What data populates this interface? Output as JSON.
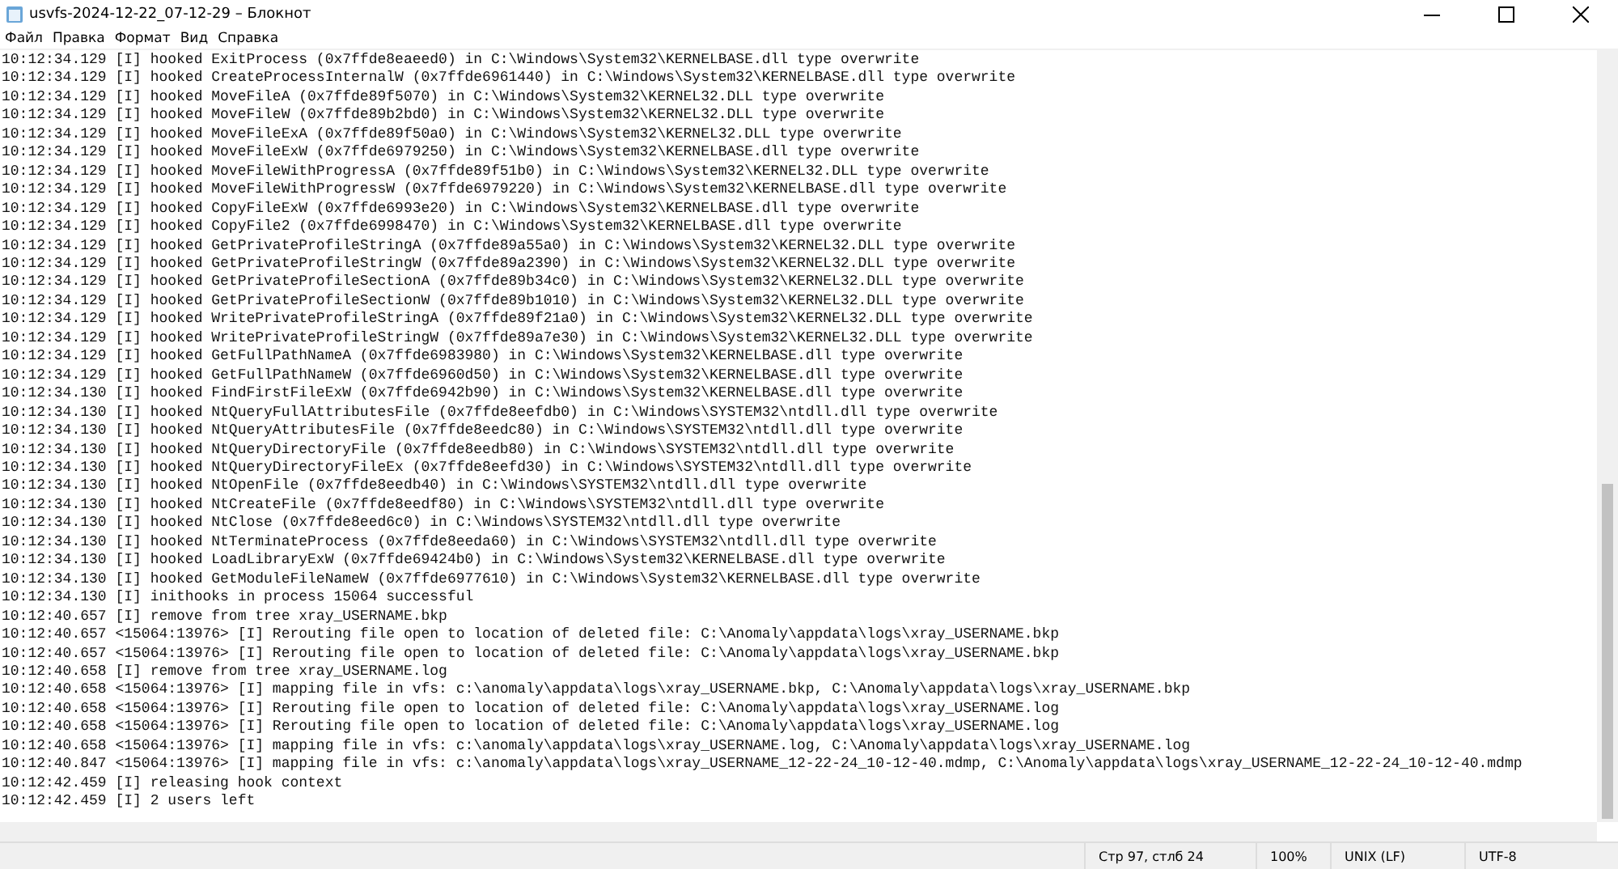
{
  "window": {
    "title": "usvfs-2024-12-22_07-12-29 – Блокнот"
  },
  "menu": [
    "Файл",
    "Правка",
    "Формат",
    "Вид",
    "Справка"
  ],
  "lines": [
    "10:12:34.129 [I] hooked ExitProcess (0x7ffde8eaeed0) in C:\\Windows\\System32\\KERNELBASE.dll type overwrite",
    "10:12:34.129 [I] hooked CreateProcessInternalW (0x7ffde6961440) in C:\\Windows\\System32\\KERNELBASE.dll type overwrite",
    "10:12:34.129 [I] hooked MoveFileA (0x7ffde89f5070) in C:\\Windows\\System32\\KERNEL32.DLL type overwrite",
    "10:12:34.129 [I] hooked MoveFileW (0x7ffde89b2bd0) in C:\\Windows\\System32\\KERNEL32.DLL type overwrite",
    "10:12:34.129 [I] hooked MoveFileExA (0x7ffde89f50a0) in C:\\Windows\\System32\\KERNEL32.DLL type overwrite",
    "10:12:34.129 [I] hooked MoveFileExW (0x7ffde6979250) in C:\\Windows\\System32\\KERNELBASE.dll type overwrite",
    "10:12:34.129 [I] hooked MoveFileWithProgressA (0x7ffde89f51b0) in C:\\Windows\\System32\\KERNEL32.DLL type overwrite",
    "10:12:34.129 [I] hooked MoveFileWithProgressW (0x7ffde6979220) in C:\\Windows\\System32\\KERNELBASE.dll type overwrite",
    "10:12:34.129 [I] hooked CopyFileExW (0x7ffde6993e20) in C:\\Windows\\System32\\KERNELBASE.dll type overwrite",
    "10:12:34.129 [I] hooked CopyFile2 (0x7ffde6998470) in C:\\Windows\\System32\\KERNELBASE.dll type overwrite",
    "10:12:34.129 [I] hooked GetPrivateProfileStringA (0x7ffde89a55a0) in C:\\Windows\\System32\\KERNEL32.DLL type overwrite",
    "10:12:34.129 [I] hooked GetPrivateProfileStringW (0x7ffde89a2390) in C:\\Windows\\System32\\KERNEL32.DLL type overwrite",
    "10:12:34.129 [I] hooked GetPrivateProfileSectionA (0x7ffde89b34c0) in C:\\Windows\\System32\\KERNEL32.DLL type overwrite",
    "10:12:34.129 [I] hooked GetPrivateProfileSectionW (0x7ffde89b1010) in C:\\Windows\\System32\\KERNEL32.DLL type overwrite",
    "10:12:34.129 [I] hooked WritePrivateProfileStringA (0x7ffde89f21a0) in C:\\Windows\\System32\\KERNEL32.DLL type overwrite",
    "10:12:34.129 [I] hooked WritePrivateProfileStringW (0x7ffde89a7e30) in C:\\Windows\\System32\\KERNEL32.DLL type overwrite",
    "10:12:34.129 [I] hooked GetFullPathNameA (0x7ffde6983980) in C:\\Windows\\System32\\KERNELBASE.dll type overwrite",
    "10:12:34.129 [I] hooked GetFullPathNameW (0x7ffde6960d50) in C:\\Windows\\System32\\KERNELBASE.dll type overwrite",
    "10:12:34.130 [I] hooked FindFirstFileExW (0x7ffde6942b90) in C:\\Windows\\System32\\KERNELBASE.dll type overwrite",
    "10:12:34.130 [I] hooked NtQueryFullAttributesFile (0x7ffde8eefdb0) in C:\\Windows\\SYSTEM32\\ntdll.dll type overwrite",
    "10:12:34.130 [I] hooked NtQueryAttributesFile (0x7ffde8eedc80) in C:\\Windows\\SYSTEM32\\ntdll.dll type overwrite",
    "10:12:34.130 [I] hooked NtQueryDirectoryFile (0x7ffde8eedb80) in C:\\Windows\\SYSTEM32\\ntdll.dll type overwrite",
    "10:12:34.130 [I] hooked NtQueryDirectoryFileEx (0x7ffde8eefd30) in C:\\Windows\\SYSTEM32\\ntdll.dll type overwrite",
    "10:12:34.130 [I] hooked NtOpenFile (0x7ffde8eedb40) in C:\\Windows\\SYSTEM32\\ntdll.dll type overwrite",
    "10:12:34.130 [I] hooked NtCreateFile (0x7ffde8eedf80) in C:\\Windows\\SYSTEM32\\ntdll.dll type overwrite",
    "10:12:34.130 [I] hooked NtClose (0x7ffde8eed6c0) in C:\\Windows\\SYSTEM32\\ntdll.dll type overwrite",
    "10:12:34.130 [I] hooked NtTerminateProcess (0x7ffde8eeda60) in C:\\Windows\\SYSTEM32\\ntdll.dll type overwrite",
    "10:12:34.130 [I] hooked LoadLibraryExW (0x7ffde69424b0) in C:\\Windows\\System32\\KERNELBASE.dll type overwrite",
    "10:12:34.130 [I] hooked GetModuleFileNameW (0x7ffde6977610) in C:\\Windows\\System32\\KERNELBASE.dll type overwrite",
    "10:12:34.130 [I] inithooks in process 15064 successful",
    "10:12:40.657 [I] remove from tree xray_USERNAME.bkp",
    "10:12:40.657 <15064:13976> [I] Rerouting file open to location of deleted file: C:\\Anomaly\\appdata\\logs\\xray_USERNAME.bkp",
    "10:12:40.657 <15064:13976> [I] Rerouting file open to location of deleted file: C:\\Anomaly\\appdata\\logs\\xray_USERNAME.bkp",
    "10:12:40.658 [I] remove from tree xray_USERNAME.log",
    "10:12:40.658 <15064:13976> [I] mapping file in vfs: c:\\anomaly\\appdata\\logs\\xray_USERNAME.bkp, C:\\Anomaly\\appdata\\logs\\xray_USERNAME.bkp",
    "10:12:40.658 <15064:13976> [I] Rerouting file open to location of deleted file: C:\\Anomaly\\appdata\\logs\\xray_USERNAME.log",
    "10:12:40.658 <15064:13976> [I] Rerouting file open to location of deleted file: C:\\Anomaly\\appdata\\logs\\xray_USERNAME.log",
    "10:12:40.658 <15064:13976> [I] mapping file in vfs: c:\\anomaly\\appdata\\logs\\xray_USERNAME.log, C:\\Anomaly\\appdata\\logs\\xray_USERNAME.log",
    "10:12:40.847 <15064:13976> [I] mapping file in vfs: c:\\anomaly\\appdata\\logs\\xray_USERNAME_12-22-24_10-12-40.mdmp, C:\\Anomaly\\appdata\\logs\\xray_USERNAME_12-22-24_10-12-40.mdmp",
    "10:12:42.459 [I] releasing hook context",
    "10:12:42.459 [I] 2 users left"
  ],
  "status_bar": {
    "position": "Стр 97, стлб 24",
    "zoom": "100%",
    "line_endings": "UNIX (LF)",
    "encoding": "UTF-8"
  }
}
